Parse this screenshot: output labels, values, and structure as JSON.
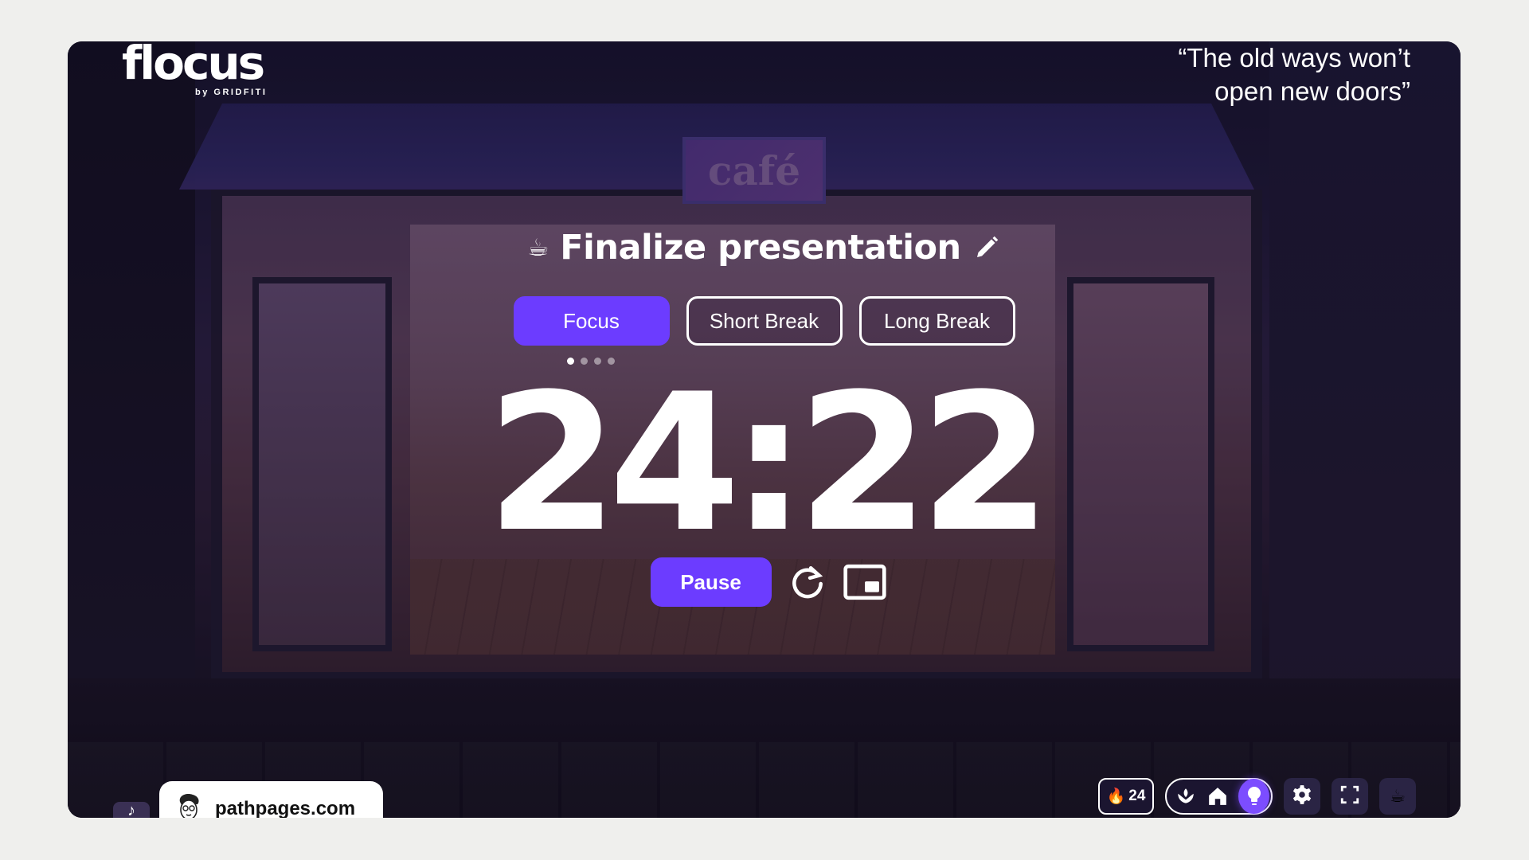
{
  "app": {
    "logo_name": "flocus",
    "logo_byline": "by GRIDFITI"
  },
  "quote": {
    "line1": "“The old ways won’t",
    "line2": "open new doors”"
  },
  "scene": {
    "sign_text": "café"
  },
  "task": {
    "emoji": "☕",
    "title": "Finalize presentation",
    "edit_icon": "pencil-icon"
  },
  "modes": [
    {
      "label": "Focus",
      "active": true
    },
    {
      "label": "Short Break",
      "active": false
    },
    {
      "label": "Long Break",
      "active": false
    }
  ],
  "session_dots": {
    "total": 4,
    "current": 1
  },
  "timer": {
    "display": "24:22"
  },
  "controls": {
    "pause_label": "Pause",
    "reset_icon": "reset-icon",
    "pip_icon": "picture-in-picture-icon"
  },
  "toolbar": {
    "streak_icon": "fire",
    "streak_count": "24",
    "scene_options": [
      "plant-icon",
      "home-icon",
      "lightbulb-icon"
    ],
    "active_scene": "lightbulb-icon",
    "settings_icon": "gear-icon",
    "fullscreen_icon": "fullscreen-icon",
    "theme_emoji": "☕"
  },
  "music": {
    "icon": "♪"
  },
  "promo": {
    "text": "pathpages.com"
  },
  "colors": {
    "accent": "#6c3cff",
    "page_bg": "#efefed",
    "tool_bg": "#2a2444"
  }
}
